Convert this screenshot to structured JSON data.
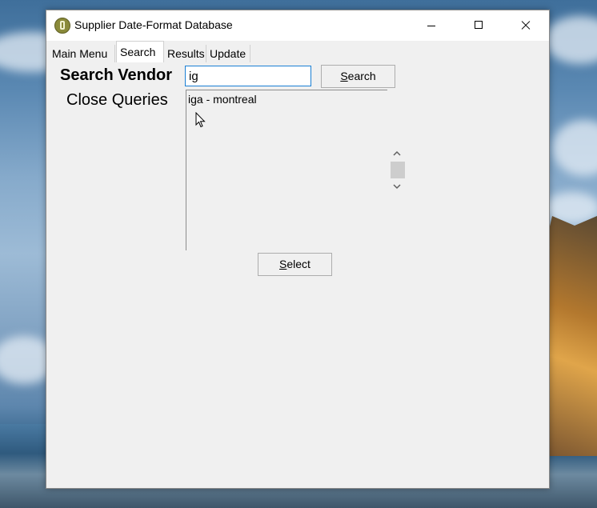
{
  "window": {
    "title": "Supplier Date-Format Database",
    "icon": "app-icon"
  },
  "tabs": [
    {
      "label": "Main Menu",
      "active": false
    },
    {
      "label": "Search",
      "active": true
    },
    {
      "label": "Results",
      "active": false
    },
    {
      "label": "Update",
      "active": false
    }
  ],
  "sidebar": {
    "search_vendor": "Search Vendor",
    "close_queries": "Close Queries"
  },
  "search": {
    "value": "ig",
    "button_label_first": "S",
    "button_label_rest": "earch"
  },
  "results": {
    "items": [
      "iga - montreal"
    ]
  },
  "select_button": {
    "label_first": "S",
    "label_rest": "elect"
  },
  "colors": {
    "input_focus_border": "#1a7fd4",
    "window_bg": "#f0f0f0"
  }
}
